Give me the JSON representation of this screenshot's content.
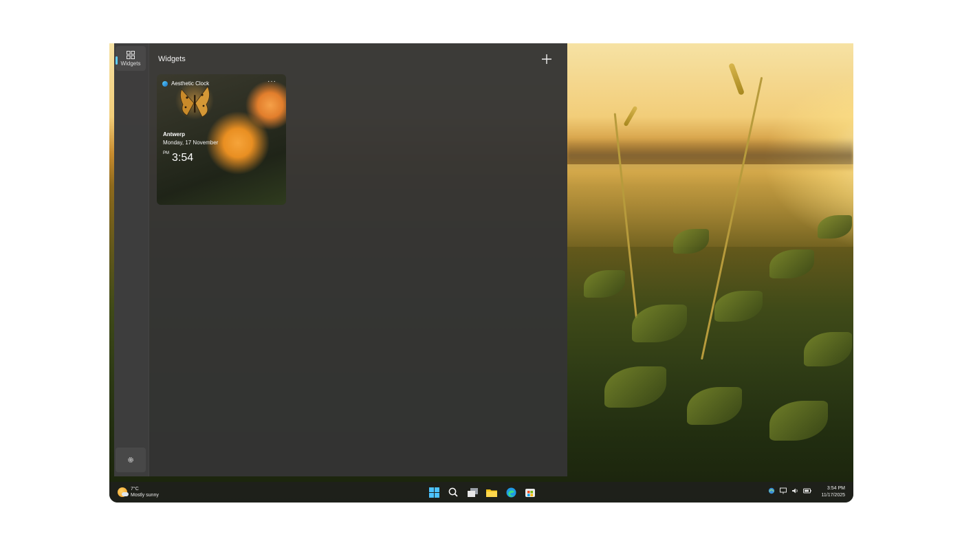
{
  "panel": {
    "sidebar": {
      "widgets_label": "Widgets"
    },
    "title": "Widgets",
    "add_label": "+"
  },
  "widget": {
    "name": "Aesthetic Clock",
    "more_label": "···",
    "city": "Antwerp",
    "date": "Monday, 17 November",
    "ampm": "PM",
    "time": "3:54"
  },
  "taskbar": {
    "weather": {
      "temp": "7°C",
      "condition": "Mostly sunny"
    },
    "pinned": [
      "start-icon",
      "search-icon",
      "task-view-icon",
      "file-explorer-icon",
      "edge-icon",
      "store-icon"
    ],
    "tray": [
      "network-icon",
      "display-icon",
      "volume-icon",
      "battery-icon"
    ],
    "clock": {
      "time": "3:54 PM",
      "date": "11/17/2025"
    }
  },
  "colors": {
    "panel_bg": "#343434",
    "accent": "#60cdff",
    "taskbar_bg": "#1e201c"
  }
}
